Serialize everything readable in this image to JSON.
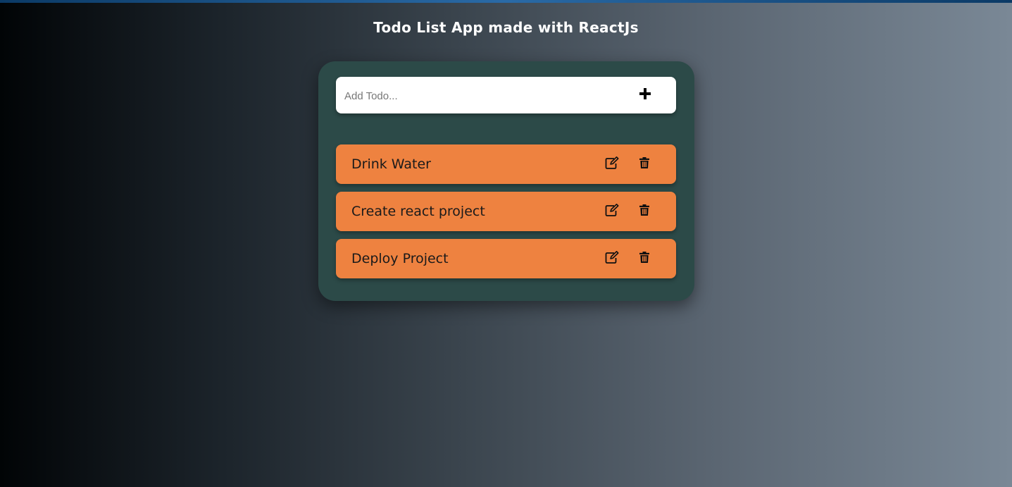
{
  "header": {
    "title": "Todo List App made with ReactJs"
  },
  "add_todo": {
    "placeholder": "Add Todo...",
    "value": "",
    "add_icon": "plus-icon"
  },
  "todos": [
    {
      "text": "Drink Water",
      "edit_icon": "edit-icon",
      "delete_icon": "trash-icon"
    },
    {
      "text": "Create react project",
      "edit_icon": "edit-icon",
      "delete_icon": "trash-icon"
    },
    {
      "text": "Deploy Project",
      "edit_icon": "edit-icon",
      "delete_icon": "trash-icon"
    }
  ],
  "colors": {
    "card_background": "#2c4a48",
    "todo_item_background": "#ee8240",
    "input_background": "#ffffff",
    "title_text": "#ffffff"
  }
}
